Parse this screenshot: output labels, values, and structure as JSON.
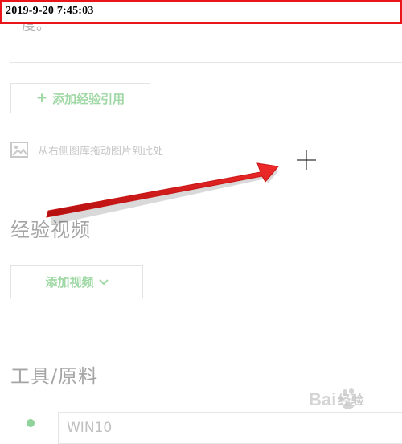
{
  "overlay": {
    "timestamp": "2019-9-20 7:45:03",
    "frame_color": "#e8151b"
  },
  "editor": {
    "text_snippet": "度。"
  },
  "reference": {
    "add_label": "添加经验引用",
    "plus_glyph": "+",
    "icon": "plus-icon"
  },
  "image_drop": {
    "hint": "从右侧图库拖动图片到此处",
    "icon": "image-icon"
  },
  "video_section": {
    "title": "经验视频",
    "add_label": "添加视频",
    "icon": "chevron-down-icon"
  },
  "tools_section": {
    "title": "工具/原料",
    "first_item_value": "WIN10"
  },
  "watermark": {
    "text": "经验"
  },
  "colors": {
    "accent_green": "#9fd8a5",
    "muted_text": "#a5a5a5",
    "arrow_red": "#e01b1b"
  }
}
